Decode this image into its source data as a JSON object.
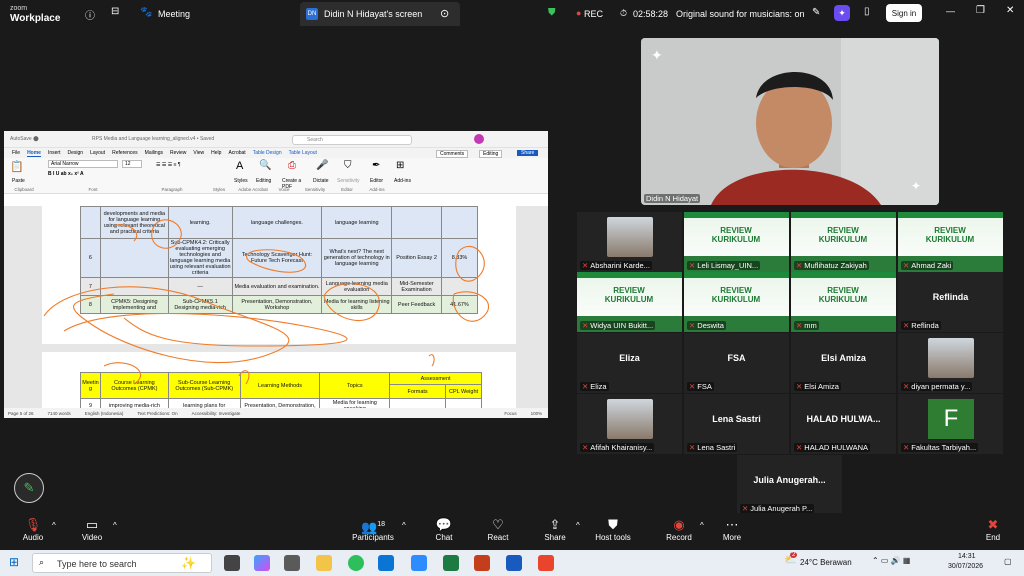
{
  "app": {
    "brand_top": "zoom",
    "brand_bottom": "Workplace",
    "tab_meeting": "Meeting",
    "tab_screen": "Didin N Hidayat's screen",
    "screen_initials": "DN",
    "rec": "REC",
    "timer": "02:58:28",
    "sound": "Original sound for musicians: on",
    "signin": "Sign in"
  },
  "doc": {
    "title": "RPS Media and Language learning_aligned.v4 • Saved",
    "search": "Search",
    "menu": [
      "File",
      "Home",
      "Insert",
      "Design",
      "Layout",
      "References",
      "Mailings",
      "Review",
      "View",
      "Help",
      "Acrobat",
      "Table Design",
      "Table Layout"
    ],
    "comments": "Comments",
    "editing": "Editing",
    "share": "Share",
    "font": "Arial Narrow",
    "size": "12",
    "tools": [
      "Paste",
      "Styles",
      "Editing",
      "Create a PDF",
      "Dictate",
      "Sensitivity",
      "Editor",
      "Add-ins"
    ],
    "groups": [
      "Clipboard",
      "Font",
      "Paragraph",
      "Styles",
      "Adobe Acrobat",
      "Voice",
      "Sensitivity",
      "Editor",
      "Add-ins"
    ],
    "rows": [
      {
        "c1": "",
        "c2": "developments and media for language learning using relevant theoretical and practical criteria",
        "c3": "learning.",
        "c4": "language challenges.",
        "c5": "language learning",
        "c6": "",
        "c7": ""
      },
      {
        "c1": "6",
        "c2": "",
        "c3": "Sub-CPMK4.2: Critically evaluating emerging technologies and language learning media using relevant evaluation criteria",
        "c4": "Technology Scavenger Hunt: Future Tech Forecast",
        "c5": "What's next? The next generation of technology in language learning",
        "c6": "Position Essay 2",
        "c7": "8.33%"
      },
      {
        "c1": "7",
        "c2": "—",
        "c3": "—",
        "c4": "Media evaluation and examination.",
        "c5": "Language learning media evaluation",
        "c6": "Mid-Semester Examination",
        "c7": ""
      },
      {
        "c1": "8",
        "c2": "CPMK5: Designing implementing and",
        "c3": "Sub-CPMK5.1 Designing media-rich",
        "c4": "Presentation, Demonstration, Workshop",
        "c5": "Media for learning listening skills",
        "c6": "Peer Feedback",
        "c7": "41.67%"
      }
    ],
    "hdr": {
      "c1": "Meetin g",
      "c2": "Course Learning Outcomes (CPMK)",
      "c3": "Sub-Course Learning Outcomes (Sub-CPMK)",
      "c4": "Learning Methods",
      "c5": "Topics",
      "assess": "Assessment",
      "formats": "Formats",
      "weight": "CPL Weight"
    },
    "row9": {
      "c1": "9",
      "c2": "improving media-rich",
      "c3": "learning plans for",
      "c4": "Presentation, Demonstration,",
      "c5": "Media for learning speaking"
    },
    "status": [
      "Page 5 of 26",
      "7140 words",
      "English (Indonesia)",
      "Text Predictions: On",
      "Accessibility: Investigate",
      "Focus",
      "100%"
    ]
  },
  "speaker": {
    "name": "Didin N Hidayat"
  },
  "participants": [
    {
      "name": "Absharini Karde...",
      "type": "photo"
    },
    {
      "name": "Leli Lismay_UIN...",
      "type": "review"
    },
    {
      "name": "Muflihatuz Zakiyah",
      "type": "review"
    },
    {
      "name": "Ahmad Zaki",
      "type": "review"
    },
    {
      "name": "Widya UIN Bukitt...",
      "type": "review"
    },
    {
      "name": "Deswita",
      "type": "review"
    },
    {
      "name": "mm",
      "type": "review"
    },
    {
      "name": "Reflinda",
      "type": "text",
      "big": "Reflinda"
    },
    {
      "name": "Eliza",
      "type": "text",
      "big": "Eliza"
    },
    {
      "name": "FSA",
      "type": "text",
      "big": "FSA"
    },
    {
      "name": "Elsi Amiza",
      "type": "text",
      "big": "Elsi Amiza"
    },
    {
      "name": "diyan permata y...",
      "type": "photo"
    },
    {
      "name": "Afifah Khairanisy...",
      "type": "photo"
    },
    {
      "name": "Lena Sastri",
      "type": "text",
      "big": "Lena Sastri"
    },
    {
      "name": "HALAD HULWANA",
      "type": "text",
      "big": "HALAD  HULWA..."
    },
    {
      "name": "Fakultas Tarbiyah...",
      "type": "letter",
      "big": "F"
    },
    {
      "name": "Julia Anugerah P...",
      "type": "text",
      "big": "Julia  Anugerah..."
    }
  ],
  "review_text": "REVIEW KURIKULUM",
  "controls": {
    "audio": "Audio",
    "video": "Video",
    "participants": "Participants",
    "count": "18",
    "chat": "Chat",
    "react": "React",
    "share": "Share",
    "host": "Host tools",
    "record": "Record",
    "more": "More",
    "end": "End"
  },
  "taskbar": {
    "search": "Type here to search",
    "weather": "24°C  Berawan",
    "time": "14:31",
    "date": "30/07/2026",
    "badge": "2"
  }
}
